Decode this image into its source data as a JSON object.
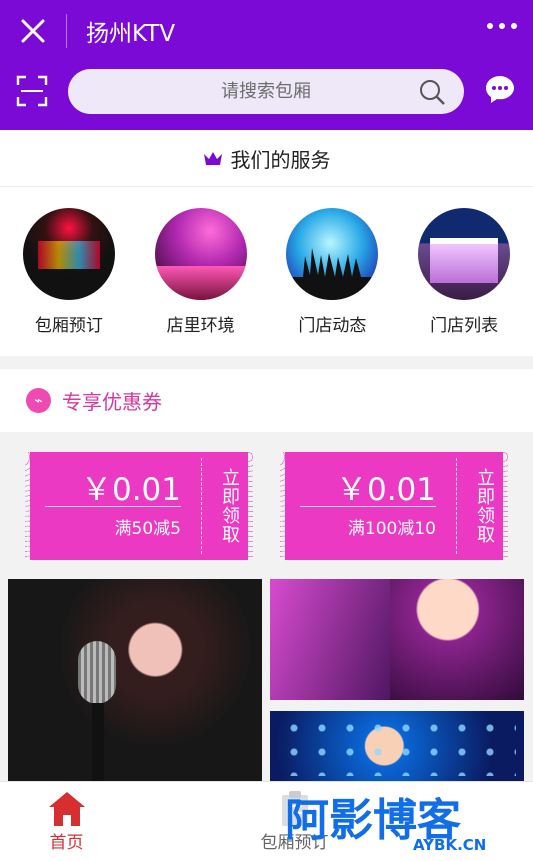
{
  "header": {
    "title": "扬州KTV"
  },
  "search": {
    "placeholder": "请搜索包厢"
  },
  "services": {
    "title": "我们的服务",
    "items": [
      {
        "label": "包厢预订"
      },
      {
        "label": "店里环境"
      },
      {
        "label": "门店动态"
      },
      {
        "label": "门店列表"
      }
    ]
  },
  "coupons": {
    "title": "专享优惠券",
    "items": [
      {
        "price": "￥0.01",
        "condition": "满50减5",
        "action": "立即领取"
      },
      {
        "price": "￥0.01",
        "condition": "满100减10",
        "action": "立即领取"
      }
    ]
  },
  "nav": {
    "items": [
      {
        "label": "首页"
      },
      {
        "label": "包厢预订"
      },
      {
        "label": ""
      },
      {
        "label": ""
      }
    ]
  },
  "watermark": {
    "main": "阿影博客",
    "sub": "AYBK.CN"
  },
  "colors": {
    "brand": "#7b0ad6",
    "coupon": "#eb39c4",
    "active": "#d72f2f"
  }
}
